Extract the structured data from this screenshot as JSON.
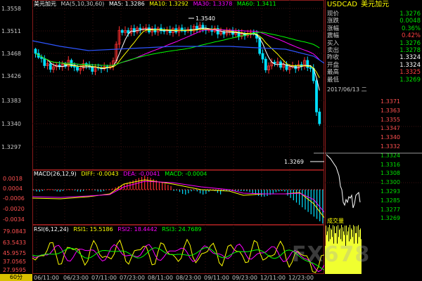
{
  "main_chart": {
    "symbol": "美元加元",
    "ma_params": "MA(5,10,30,60)",
    "ma5": "MA5: 1.3286",
    "ma10": "MA10: 1.3292",
    "ma30": "MA30: 1.3378",
    "ma60": "MA60: 1.3411",
    "y_labels": [
      "1.3558",
      "1.3511",
      "1.3468",
      "1.3426",
      "1.3383",
      "1.3340",
      "1.3297"
    ],
    "high_marker": "1.3540",
    "low_marker": "1.3269"
  },
  "macd": {
    "params": "MACD(26,12,9)",
    "diff": "DIFF: -0.0043",
    "dea": "DEA: -0.0041",
    "macd": "MACD: -0.0004",
    "y_labels": [
      "0.0018",
      "0.0004",
      "-0.0006",
      "-0.0020",
      "-0.0034"
    ]
  },
  "rsi": {
    "params": "RSI(6,12,24)",
    "rsi1": "RSI1: 15.5186",
    "rsi2": "RSI2: 18.4442",
    "rsi3": "RSI3: 24.7689",
    "y_labels": [
      "79.0843",
      "63.5433",
      "45.9575",
      "37.0565",
      "27.9595"
    ]
  },
  "x_axis": {
    "period": "60分",
    "labels": [
      "06/11:00",
      "06/23:00",
      "07/11:00",
      "07/23:00",
      "08/11:00",
      "08/23:00",
      "09/11:00",
      "09/23:00",
      "12/11:00",
      "12/23:00"
    ]
  },
  "quote": {
    "code": "USDCAD",
    "name": "美元加元",
    "rows": [
      {
        "label": "现价",
        "value": "1.3276",
        "color": "#00e000"
      },
      {
        "label": "涨跌",
        "value": "0.0048",
        "color": "#00e000"
      },
      {
        "label": "涨幅",
        "value": "0.36%",
        "color": "#00e000"
      },
      {
        "label": "震幅",
        "value": "0.42%",
        "color": "#ff4040"
      },
      {
        "label": "买入",
        "value": "1.3276",
        "color": "#00e000"
      },
      {
        "label": "卖出",
        "value": "1.3278",
        "color": "#00e000"
      },
      {
        "label": "昨收",
        "value": "1.3324",
        "color": "#ffffff"
      },
      {
        "label": "开盘",
        "value": "1.3324",
        "color": "#ffffff"
      },
      {
        "label": "最高",
        "value": "1.3325",
        "color": "#ff4040"
      },
      {
        "label": "最低",
        "value": "1.3269",
        "color": "#00e000"
      }
    ]
  },
  "intraday": {
    "date": "2017/06/13 二",
    "y_labels": [
      "1.3371",
      "1.3363",
      "1.3355",
      "1.3347",
      "1.3340",
      "1.3332",
      "1.3324",
      "1.3316",
      "1.3308",
      "1.3300",
      "1.3293",
      "1.3285",
      "1.3277",
      "1.3269"
    ],
    "volume_label": "成交量"
  },
  "watermark": "FX678",
  "colors": {
    "up_candle": "#ff3030",
    "down_candle": "#00e0ff",
    "ma5": "#ffffff",
    "ma10": "#ffff00",
    "ma30": "#ff00ff",
    "ma60": "#00ff00",
    "ma60_line": "#2d55ff",
    "border": "#8a1b1b"
  }
}
